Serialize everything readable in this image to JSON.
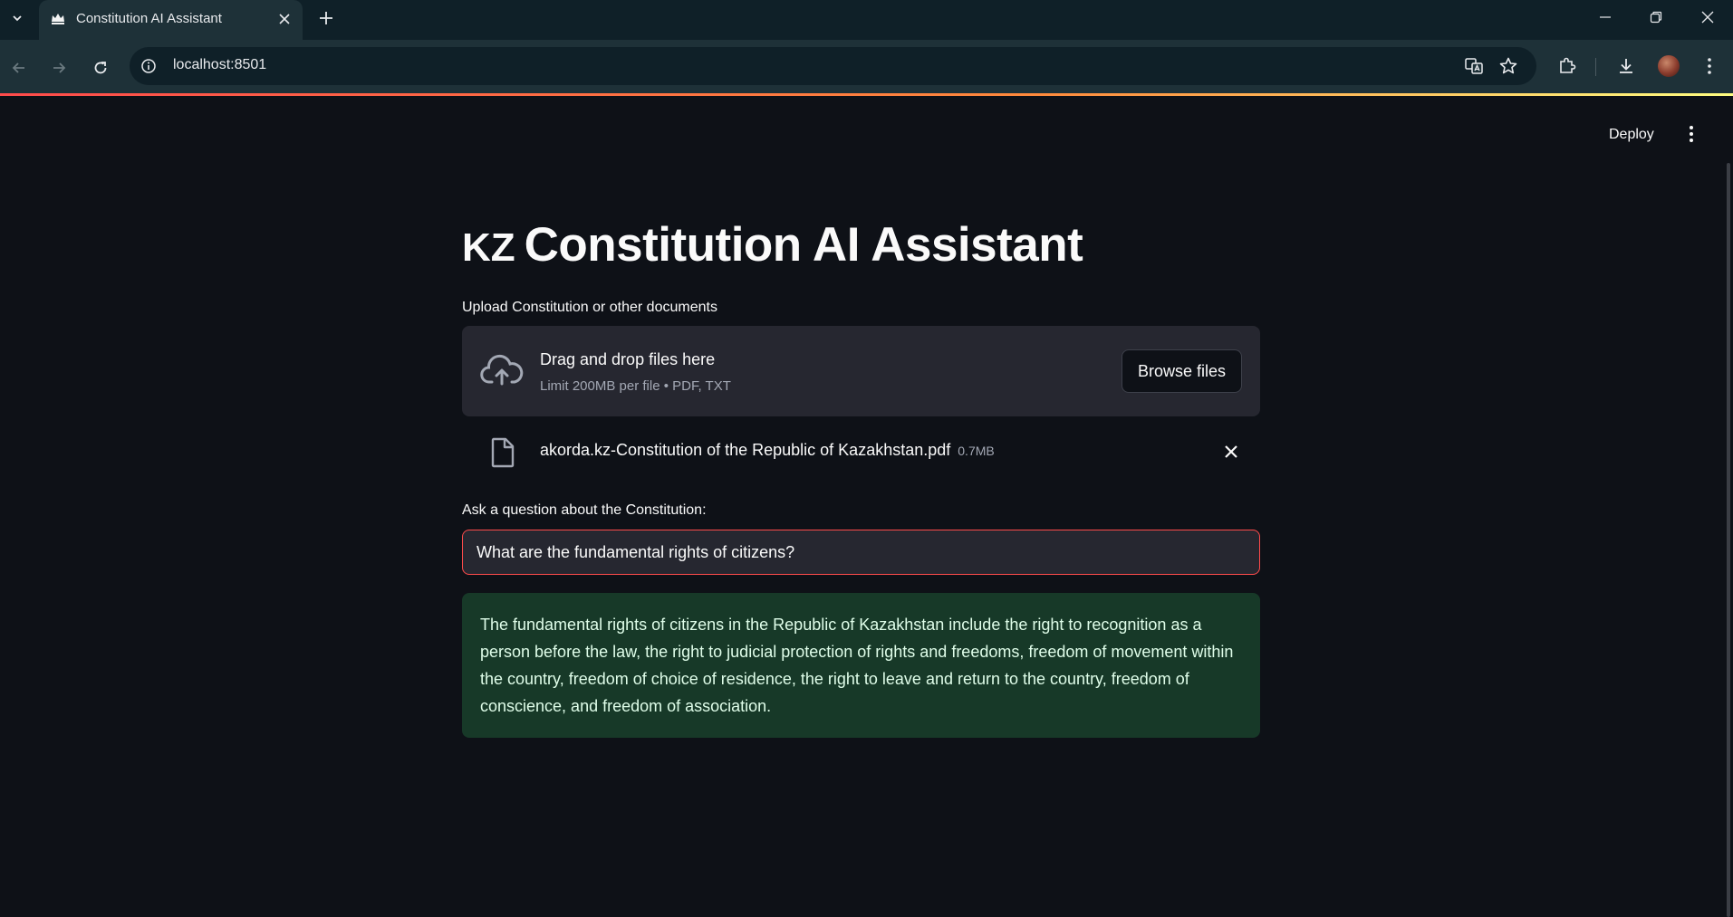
{
  "browser": {
    "tab_title": "Constitution AI Assistant",
    "url": "localhost:8501"
  },
  "header": {
    "deploy_label": "Deploy"
  },
  "app": {
    "title_flag": "KZ",
    "title": "Constitution AI Assistant",
    "uploader": {
      "label": "Upload Constitution or other documents",
      "drop_text": "Drag and drop files here",
      "limit_text": "Limit 200MB per file • PDF, TXT",
      "browse_label": "Browse files"
    },
    "uploaded_file": {
      "name": "akorda.kz-Constitution of the Republic of Kazakhstan.pdf",
      "size": "0.7MB"
    },
    "question": {
      "label": "Ask a question about the Constitution:",
      "value": "What are the fundamental rights of citizens?"
    },
    "answer": "The fundamental rights of citizens in the Republic of Kazakhstan include the right to recognition as a person before the law, the right to judicial protection of rights and freedoms, freedom of movement within the country, freedom of choice of residence, the right to leave and return to the country, freedom of conscience, and freedom of association."
  },
  "colors": {
    "background": "#0e1117",
    "accent": "#ff4b4b",
    "success_bg": "#173928",
    "success_text": "#dffde9"
  }
}
